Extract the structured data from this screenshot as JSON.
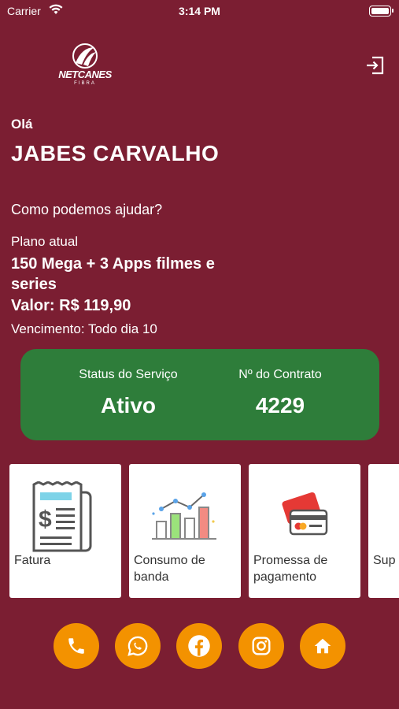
{
  "status_bar": {
    "carrier": "Carrier",
    "time": "3:14 PM"
  },
  "logo": {
    "brand": "NETCANES",
    "sub": "FIBRA"
  },
  "greeting": {
    "hello": "Olá",
    "name": "JABES CARVALHO",
    "question": "Como podemos ajudar?"
  },
  "plan": {
    "label": "Plano atual",
    "name": "150  Mega + 3 Apps filmes e series",
    "value": "Valor: R$ 119,90",
    "due": "Vencimento: Todo dia 10"
  },
  "service_status": {
    "status_label": "Status do Serviço",
    "status_value": "Ativo",
    "contract_label": "Nº do Contrato",
    "contract_value": "4229"
  },
  "services": [
    {
      "label": "Fatura",
      "icon": "invoice-icon"
    },
    {
      "label": "Consumo de banda",
      "icon": "bandwidth-chart-icon"
    },
    {
      "label": "Promessa de pagamento",
      "icon": "credit-card-icon"
    },
    {
      "label": "Sup",
      "icon": "support-icon"
    }
  ],
  "social": [
    {
      "icon": "phone-icon"
    },
    {
      "icon": "whatsapp-icon"
    },
    {
      "icon": "facebook-icon"
    },
    {
      "icon": "instagram-icon"
    },
    {
      "icon": "home-icon"
    }
  ],
  "colors": {
    "background": "#7b1e32",
    "status_card": "#2e7d3a",
    "social_button": "#f39200",
    "card": "#ffffff"
  }
}
